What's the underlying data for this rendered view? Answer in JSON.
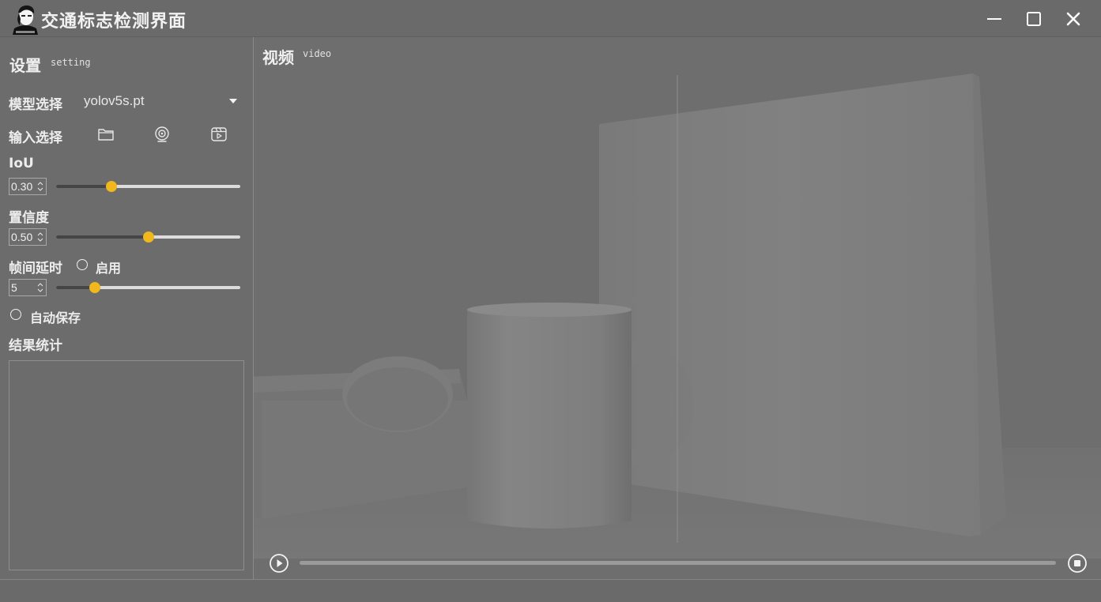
{
  "window": {
    "title": "交通标志检测界面",
    "controls": [
      "minimize-icon",
      "maximize-icon",
      "close-icon"
    ]
  },
  "sidebar": {
    "title": "设置",
    "subtitle": "setting",
    "model_label": "模型选择",
    "model_value": "yolov5s.pt",
    "input_label": "输入选择",
    "input_icons": [
      "folder-icon",
      "webcam-icon",
      "video-file-icon"
    ],
    "iou": {
      "label": "IoU",
      "value": "0.30",
      "slider_fraction": 0.3
    },
    "confidence": {
      "label": "置信度",
      "value": "0.50",
      "slider_fraction": 0.5
    },
    "frame_delay": {
      "label": "帧间延时",
      "enable_label": "启用",
      "value": "5",
      "slider_fraction": 0.21
    },
    "auto_save_label": "自动保存",
    "stats_label": "结果统计"
  },
  "main": {
    "title": "视频",
    "subtitle": "video",
    "progress": 0.0
  },
  "colors": {
    "accent": "#f0b81c",
    "background": "#6b6b6b",
    "text": "#ececec"
  }
}
